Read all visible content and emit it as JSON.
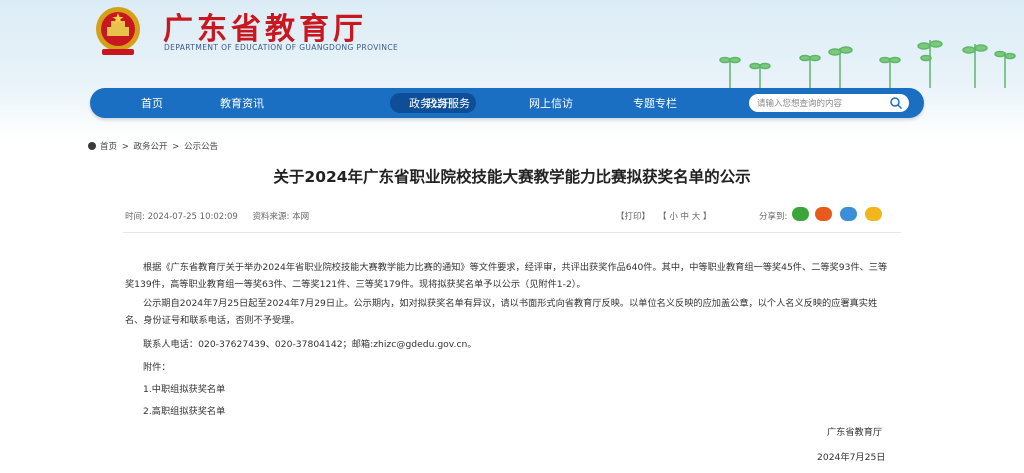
{
  "header": {
    "title": "广东省教育厅",
    "subtitle_en": "DEPARTMENT OF EDUCATION OF GUANGDONG PROVINCE"
  },
  "nav": {
    "items": [
      "首页",
      "教育资讯",
      "政务公开",
      "政务服务",
      "网上信访",
      "专题专栏"
    ],
    "active": "政务公开",
    "search_placeholder": "请输入您想查询的内容"
  },
  "breadcrumb": [
    "首页",
    ">",
    "政务公开",
    ">",
    "公示公告"
  ],
  "article": {
    "title": "关于2024年广东省职业院校技能大赛教学能力比赛拟获奖名单的公示",
    "time": "时间: 2024-07-25 10:02:09",
    "source": "资料来源: 本网",
    "print": "【打印】",
    "font_size": "【 小   中   大 】",
    "share_label": "分享到:",
    "paragraph1": "根据《广东省教育厅关于举办2024年省职业院校技能大赛教学能力比赛的通知》等文件要求，经评审，共评出获奖作品640件。其中，中等职业教育组一等奖45件、二等奖93件、三等奖139件，高等职业教育组一等奖63件、二等奖121件、三等奖179件。现将拟获奖名单予以公示（见附件1-2）。",
    "paragraph2": "公示期自2024年7月25日起至2024年7月29日止。公示期内，如对拟获奖名单有异议，请以书面形式向省教育厅反映。以单位名义反映的应加盖公章，以个人名义反映的应署真实姓名、身份证号和联系电话，否则不予受理。",
    "contact": "联系人电话：020-37627439、020-37804142；邮箱:zhizc@gdedu.gov.cn。",
    "attachments_label": "附件：",
    "attachments": [
      "1.中职组拟获奖名单",
      "2.高职组拟获奖名单"
    ],
    "signature": "广东省教育厅",
    "date": "2024年7月25日"
  },
  "colors": {
    "brand_red": "#c8171f",
    "nav_blue": "#1b6fc2",
    "nav_active": "#0e4e96",
    "share_wechat": "#3aa63a",
    "share_weibo": "#e85a1c",
    "share_qq": "#3a8fd6",
    "share_qzone": "#f2b51a"
  },
  "icons": [
    "national-emblem-icon",
    "search-icon",
    "home-icon",
    "wechat-icon",
    "weibo-icon",
    "qq-icon",
    "qzone-icon"
  ]
}
